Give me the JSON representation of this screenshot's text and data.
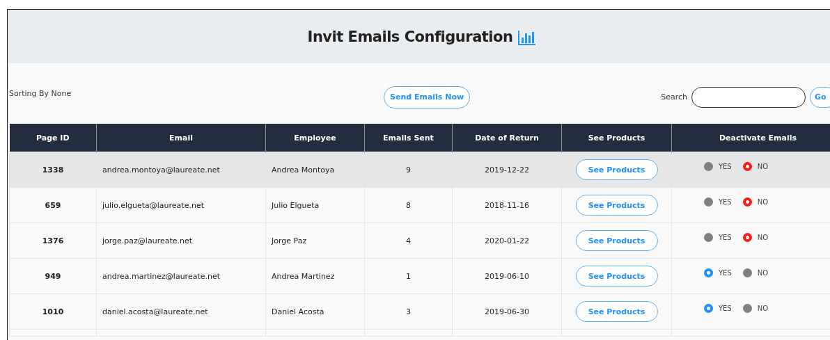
{
  "header": {
    "title": "Invit Emails Configuration"
  },
  "toolbar": {
    "sorting": "Sorting By None",
    "send_button": "Send Emails Now",
    "search_label": "Search",
    "go_button": "Go"
  },
  "table": {
    "columns": [
      "Page ID",
      "Email",
      "Employee",
      "Emails Sent",
      "Date of Return",
      "See Products",
      "Deactivate Emails"
    ],
    "rows": [
      {
        "page_id": "1338",
        "email": "andrea.montoya@laureate.net",
        "employee": "Andrea Montoya",
        "emails_sent": "9",
        "date_of_return": "2019-12-22",
        "button": "See Products",
        "highlighted": true,
        "deactivate": [
          {
            "label": "YES",
            "selected": false
          },
          {
            "label": "NO",
            "selected": true
          }
        ]
      },
      {
        "page_id": "659",
        "email": "julio.elgueta@laureate.net",
        "employee": "Julio Elgueta",
        "emails_sent": "8",
        "date_of_return": "2018-11-16",
        "button": "See Products",
        "highlighted": false,
        "deactivate": [
          {
            "label": "YES",
            "selected": false
          },
          {
            "label": "NO",
            "selected": true
          }
        ]
      },
      {
        "page_id": "1376",
        "email": "jorge.paz@laureate.net",
        "employee": "Jorge Paz",
        "emails_sent": "4",
        "date_of_return": "2020-01-22",
        "button": "See Products",
        "highlighted": false,
        "deactivate": [
          {
            "label": "YES",
            "selected": false
          },
          {
            "label": "NO",
            "selected": true
          }
        ]
      },
      {
        "page_id": "949",
        "email": "andrea.martinez@laureate.net",
        "employee": "Andrea Martinez",
        "emails_sent": "1",
        "date_of_return": "2019-06-10",
        "button": "See Products",
        "highlighted": false,
        "deactivate": [
          {
            "label": "YES",
            "selected": true
          },
          {
            "label": "NO",
            "selected": false
          }
        ]
      },
      {
        "page_id": "1010",
        "email": "daniel.acosta@laureate.net",
        "employee": "Daniel Acosta",
        "emails_sent": "3",
        "date_of_return": "2019-06-30",
        "button": "See Products",
        "highlighted": false,
        "deactivate": [
          {
            "label": "YES",
            "selected": true
          },
          {
            "label": "NO",
            "selected": false
          }
        ]
      }
    ]
  }
}
